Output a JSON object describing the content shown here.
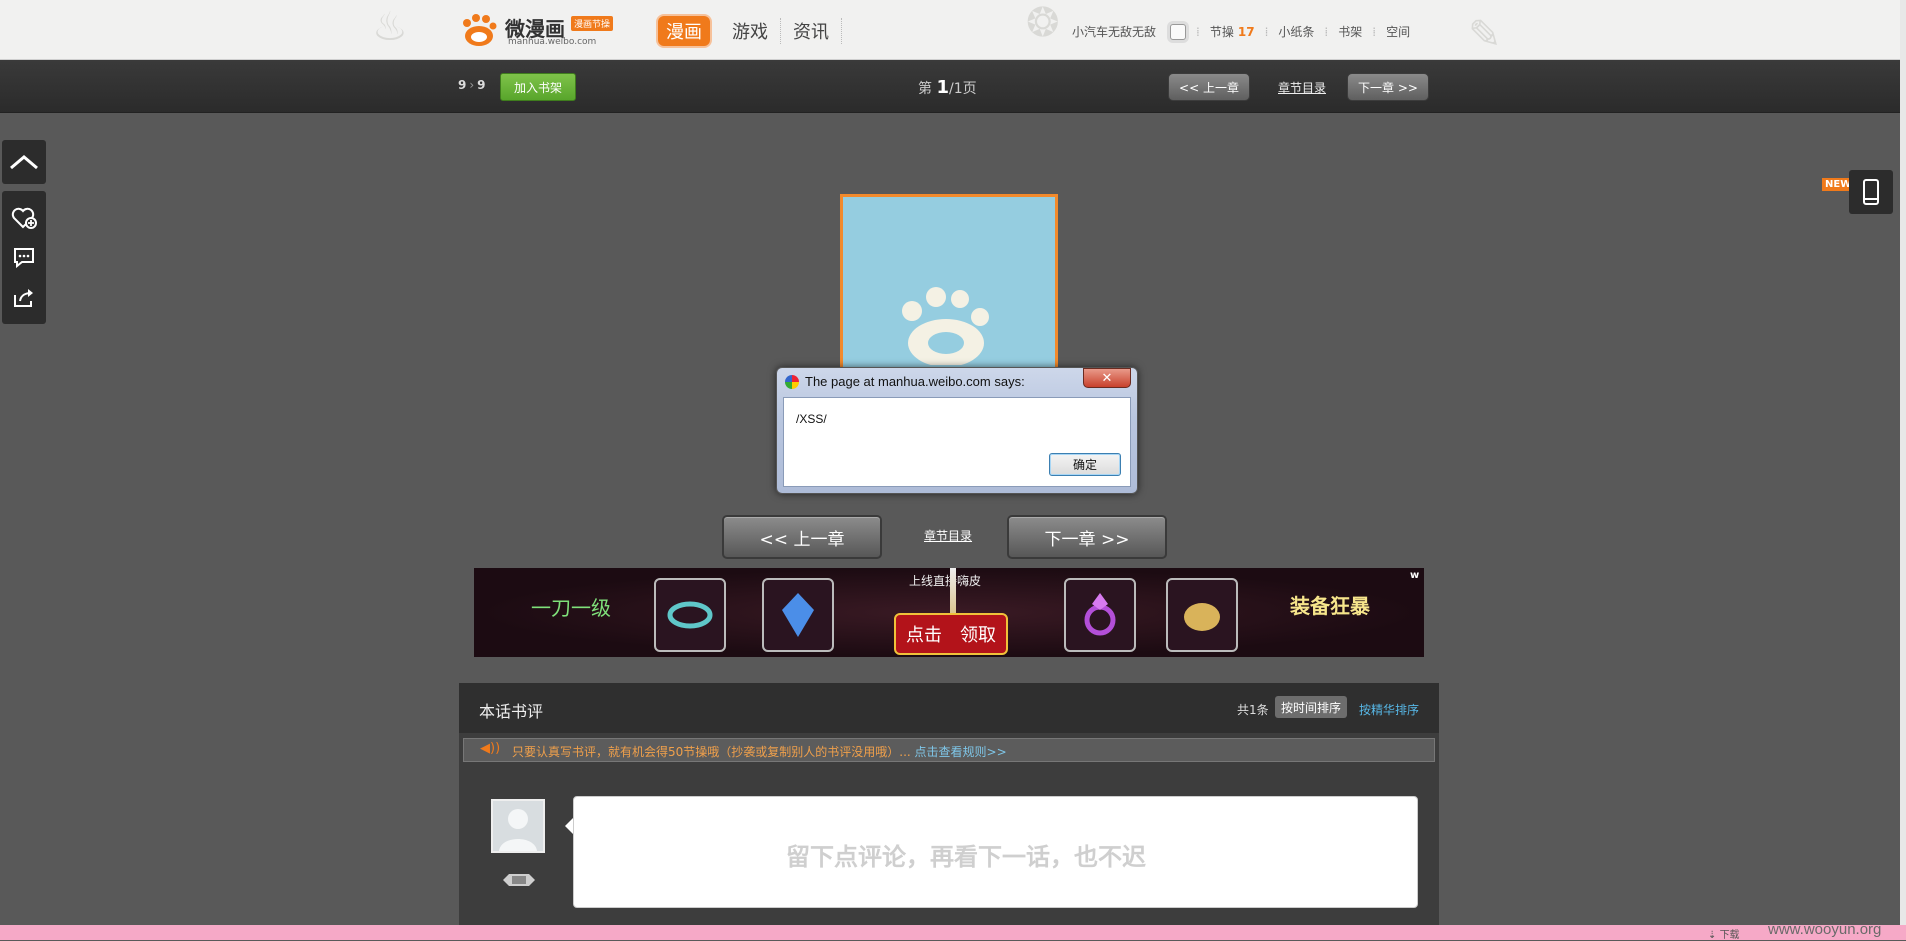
{
  "header": {
    "brand": "微漫画",
    "badge": "漫画节操",
    "domain": "manhua.weibo.com",
    "nav": [
      "漫画",
      "游戏",
      "资讯"
    ],
    "user": {
      "name": "小汽车无敌无敌",
      "jiecao_label": "节操",
      "jiecao_count": "17",
      "links": [
        "小纸条",
        "书架",
        "空间"
      ]
    }
  },
  "chapter_bar": {
    "current": "9",
    "total": "9",
    "add_shelf": "加入书架",
    "page_prefix": "第",
    "page_current": "1",
    "page_sep": "/",
    "page_total": "1",
    "page_suffix": "页",
    "prev": "<< 上一章",
    "toc": "章节目录",
    "next": "下一章 >>"
  },
  "side": {
    "new_badge": "NEW"
  },
  "dialog": {
    "title": "The page at manhua.weibo.com says:",
    "close": "✕",
    "message": "/XSS/",
    "ok": "确定"
  },
  "chapter_nav": {
    "prev": "<< 上一章",
    "toc": "章节目录",
    "next": "下一章 >>"
  },
  "ad": {
    "left_text": "一刀一级",
    "top_text": "上线直接嗨皮",
    "claim_left": "点击",
    "claim_right": "领取",
    "right_text": "装备狂暴",
    "corner": "w"
  },
  "comments": {
    "title": "本话书评",
    "total": "共1条",
    "sort_time": "按时间排序",
    "sort_best": "按精华排序",
    "notice": "只要认真写书评，就有机会得50节操哦（抄袭或复制别人的书评没用哦）...",
    "notice_link": "点击查看规则>>",
    "placeholder": "留下点评论，再看下一话，也不迟"
  },
  "footer": {
    "download": "下载",
    "watermark": "www.wooyun.org"
  }
}
